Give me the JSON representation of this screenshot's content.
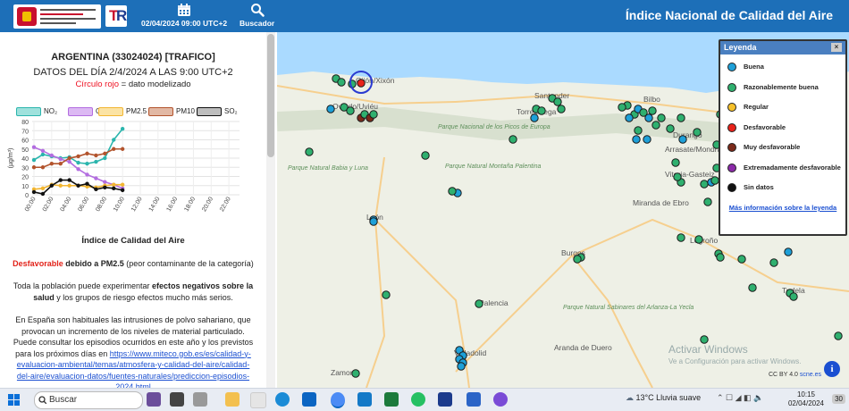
{
  "header": {
    "datetime": "02/04/2024 09:00 UTC+2",
    "search_label": "Buscador",
    "app_title": "Índice Nacional de Calidad del Aire"
  },
  "panel": {
    "station": "ARGENTINA (33024024) [TRAFICO]",
    "datetime": "DATOS DEL DÍA 2/4/2024 A LAS 9:00 UTC+2",
    "note_red": "Círculo rojo",
    "note_rest": " = dato modelizado",
    "aqi_title": "Índice de Calidad del Aire",
    "status_label": "Desfavorable",
    "status_cause": " debido a PM2.5",
    "status_detail": " (peor contaminante de la categoría)",
    "effects_1": "Toda la población puede experimentar ",
    "effects_bold": "efectos negativos sobre la salud",
    "effects_2": " y los grupos de riesgo efectos mucho más serios.",
    "dust_text": "En España son habituales las intrusiones de polvo sahariano, que provocan un incremento de los niveles de material particulado. Puede consultar los episodios ocurridos en este año y los previstos para los próximos días en ",
    "dust_link": "https://www.miteco.gob.es/es/calidad-y-evaluacion-ambiental/temas/atmosfera-y-calidad-del-aire/calidad-del-aire/evaluacion-datos/fuentes-naturales/prediccion-episodios-2024.html"
  },
  "chart_data": {
    "type": "line",
    "ylabel": "(µg/m³)",
    "ylim": [
      0,
      80
    ],
    "yticks": [
      0,
      10,
      20,
      30,
      40,
      50,
      60,
      70,
      80
    ],
    "x": [
      "00:00",
      "01:00",
      "02:00",
      "03:00",
      "04:00",
      "05:00",
      "06:00",
      "07:00",
      "08:00",
      "09:00",
      "10:00"
    ],
    "xticks": [
      "00:00",
      "02:00",
      "04:00",
      "06:00",
      "08:00",
      "10:00",
      "12:00",
      "14:00",
      "16:00",
      "18:00",
      "20:00",
      "22:00"
    ],
    "series": [
      {
        "name": "NO₂",
        "color": "#2bb5ad",
        "fill": "#9fe1dc",
        "values": [
          38,
          44,
          42,
          40,
          41,
          35,
          34,
          36,
          40,
          60,
          72
        ]
      },
      {
        "name": "O₃",
        "color": "#b36de0",
        "fill": "#dcb9f3",
        "values": [
          52,
          48,
          43,
          39,
          36,
          28,
          22,
          18,
          14,
          11,
          7
        ]
      },
      {
        "name": "PM2.5",
        "color": "#f2b632",
        "fill": "#fbe3a4",
        "values": [
          6,
          7,
          11,
          10,
          10,
          10,
          9,
          8,
          10,
          11,
          11
        ]
      },
      {
        "name": "PM10",
        "color": "#b2532c",
        "fill": "#e2b8a4",
        "values": [
          30,
          30,
          34,
          34,
          40,
          42,
          45,
          43,
          45,
          50,
          50
        ]
      },
      {
        "name": "SO₂",
        "color": "#111111",
        "fill": "#bdbdbd",
        "values": [
          3,
          1,
          10,
          16,
          16,
          10,
          12,
          6,
          8,
          7,
          5
        ]
      }
    ]
  },
  "legend": {
    "title": "Leyenda",
    "close_label": "×",
    "link": "Más información sobre la leyenda",
    "items": [
      {
        "label": "Buena",
        "color": "#1ea0d8"
      },
      {
        "label": "Razonablemente buena",
        "color": "#2fb06f"
      },
      {
        "label": "Regular",
        "color": "#f5c02a"
      },
      {
        "label": "Desfavorable",
        "color": "#e8221a"
      },
      {
        "label": "Muy desfavorable",
        "color": "#7b2a1a"
      },
      {
        "label": "Extremadamente desfavorable",
        "color": "#8b2aa8"
      },
      {
        "label": "Sin datos",
        "color": "#111111"
      }
    ]
  },
  "map": {
    "labels": [
      {
        "text": "Gijón/Xixón",
        "cls": "city"
      },
      {
        "text": "Oviedo/Uviéu",
        "cls": "city"
      },
      {
        "text": "Santander",
        "cls": "city"
      },
      {
        "text": "Torrelavega",
        "cls": "city"
      },
      {
        "text": "Bilbo",
        "cls": "city"
      },
      {
        "text": "Durango",
        "cls": "city"
      },
      {
        "text": "Arrasate/Mondragón",
        "cls": "city"
      },
      {
        "text": "Vitoria-Gasteiz",
        "cls": "city"
      },
      {
        "text": "Miranda de Ebro",
        "cls": "city"
      },
      {
        "text": "Logroño",
        "cls": "city"
      },
      {
        "text": "León",
        "cls": "city"
      },
      {
        "text": "Burgos",
        "cls": "city"
      },
      {
        "text": "Palencia",
        "cls": "city"
      },
      {
        "text": "Valladolid",
        "cls": "city"
      },
      {
        "text": "Zamora",
        "cls": "city"
      },
      {
        "text": "Aranda de Duero",
        "cls": "city"
      },
      {
        "text": "Tudela",
        "cls": "city"
      },
      {
        "text": "Parque Nacional de los Picos de Europa",
        "cls": "park"
      },
      {
        "text": "Parque Natural Babia y Luna",
        "cls": "park"
      },
      {
        "text": "Parque Natural Montaña Palentina",
        "cls": "park"
      },
      {
        "text": "Parque Natural Sabinares del Arlanza-La Yecla",
        "cls": "park"
      }
    ]
  },
  "watermark": {
    "line1": "Activar Windows",
    "line2": "Ve a Configuración para activar Windows."
  },
  "attribution": {
    "text": "CC BY 4.0",
    "link": "scne.es"
  },
  "taskbar": {
    "search_placeholder": "Buscar",
    "weather": "13°C  Lluvia suave",
    "time": "10:15",
    "date": "02/04/2024",
    "notif_count": "30"
  }
}
